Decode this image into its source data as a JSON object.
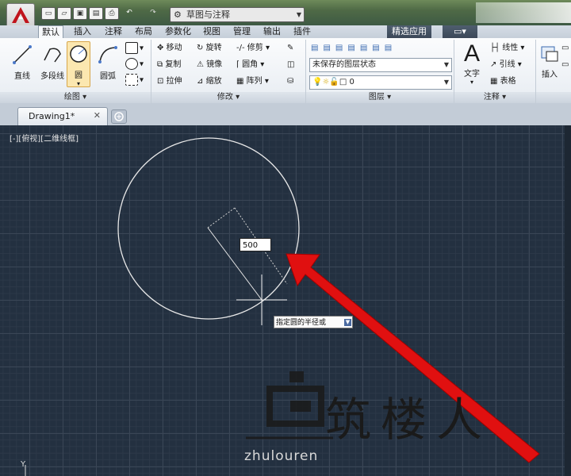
{
  "titlebar": {
    "workspace": "草图与注释"
  },
  "tabs": [
    "默认",
    "插入",
    "注释",
    "布局",
    "参数化",
    "视图",
    "管理",
    "输出",
    "插件",
    "精选应用"
  ],
  "ribbon": {
    "draw": {
      "line": "直线",
      "polyline": "多段线",
      "circle": "圆",
      "arc": "圆弧",
      "panel": "绘图 ▾"
    },
    "modify": {
      "move": "移动",
      "rotate": "旋转",
      "trim": "修剪",
      "copy": "复制",
      "mirror": "镜像",
      "fillet": "圆角",
      "stretch": "拉伸",
      "scale": "缩放",
      "array": "阵列",
      "panel": "修改 ▾"
    },
    "layers": {
      "state": "未保存的图层状态",
      "current": "0",
      "panel": "图层 ▾"
    },
    "annotation": {
      "text": "文字",
      "linear": "线性",
      "leader": "引线",
      "table": "表格",
      "panel": "注释 ▾"
    },
    "block": {
      "insert": "插入"
    }
  },
  "document": {
    "tab": "Drawing1*",
    "viewport_label": "[-][俯视][二维线框]"
  },
  "dynamic_input": {
    "radius": "500",
    "prompt": "指定圆的半径或"
  },
  "watermark": {
    "cn": "筑楼人",
    "en": "zhulouren"
  },
  "ucs": {
    "y": "Y"
  },
  "colors": {
    "arrow": "#e01010",
    "canvas": "#233040",
    "autocad_red": "#c0141c"
  }
}
